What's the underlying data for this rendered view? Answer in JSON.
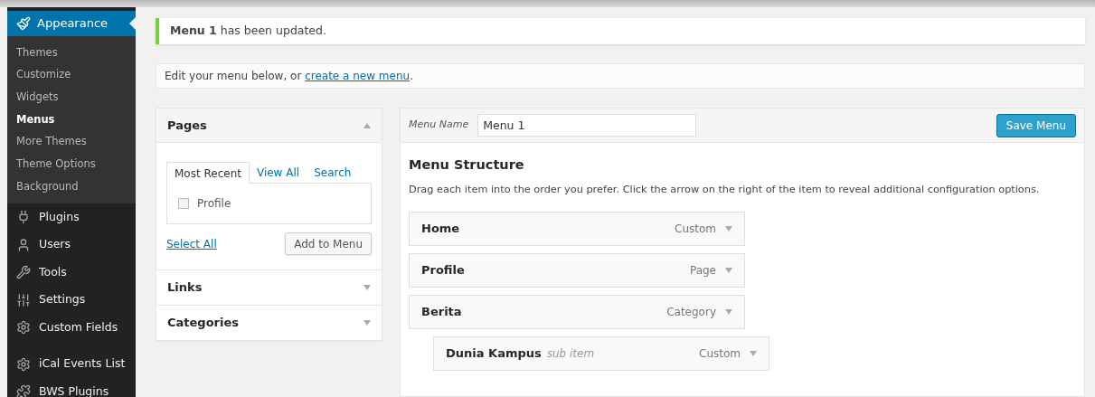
{
  "sidebar": {
    "active": {
      "label": "Appearance",
      "selected": true,
      "submenu": [
        {
          "label": "Themes",
          "selected": false
        },
        {
          "label": "Customize",
          "selected": false
        },
        {
          "label": "Widgets",
          "selected": false
        },
        {
          "label": "Menus",
          "selected": true
        },
        {
          "label": "More Themes",
          "selected": false
        },
        {
          "label": "Theme Options",
          "selected": false
        },
        {
          "label": "Background",
          "selected": false
        }
      ]
    },
    "items": [
      {
        "label": "Plugins",
        "selected": false
      },
      {
        "label": "Users",
        "selected": false
      },
      {
        "label": "Tools",
        "selected": false
      },
      {
        "label": "Settings",
        "selected": false
      },
      {
        "label": "Custom Fields",
        "selected": false
      },
      {
        "label": "iCal Events List",
        "selected": false
      },
      {
        "label": "BWS Plugins",
        "selected": false
      }
    ]
  },
  "notice": {
    "text": "**Menu 1** has been updated."
  },
  "edit_bar": {
    "text": "Edit your menu below, or ",
    "link": "create a new menu",
    "end": "."
  },
  "accordion": [
    {
      "title": "Pages",
      "expanded": true,
      "tabs": [
        {
          "label": "Most Recent",
          "selected": true
        },
        {
          "label": "View All",
          "selected": false
        },
        {
          "label": "Search",
          "selected": false
        }
      ],
      "options": [
        {
          "label": "Profile",
          "checked": false
        }
      ],
      "select_all": "Select All",
      "add_button": "Add to Menu"
    },
    {
      "title": "Links",
      "expanded": false
    },
    {
      "title": "Categories",
      "expanded": false
    }
  ],
  "menu": {
    "name_label": "Menu Name",
    "name_value": "Menu 1",
    "save_button": "Save Menu",
    "heading": "Menu Structure",
    "description": "Drag each item into the order you prefer. Click the arrow on the right of the item to reveal additional configuration options.",
    "items": [
      {
        "title": "Home",
        "type": "Custom"
      },
      {
        "title": "Profile",
        "type": "Page"
      },
      {
        "title": "Berita",
        "type": "Category",
        "children": [
          {
            "title": "Dunia Kampus",
            "note": "sub item",
            "type": "Custom"
          }
        ]
      }
    ]
  }
}
